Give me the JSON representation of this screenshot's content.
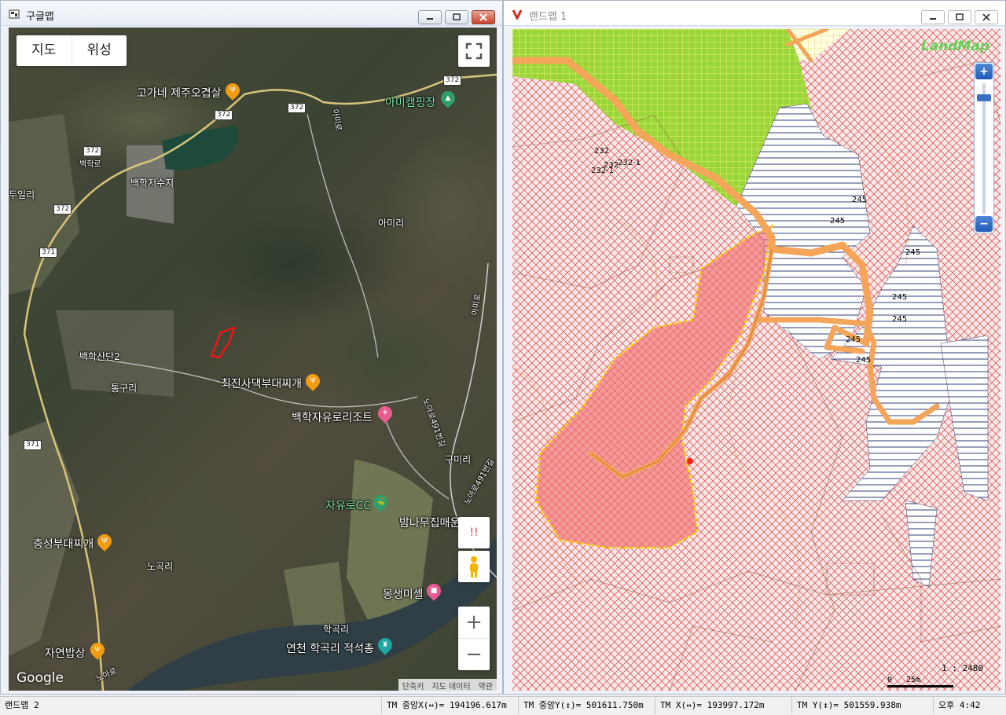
{
  "left_window": {
    "title": "구글맵",
    "map_types": [
      "지도",
      "위성"
    ],
    "labels": [
      {
        "text": "고가네 제주오겹살",
        "cls": "big"
      },
      {
        "text": "아미캠핑장",
        "cls": "big green"
      },
      {
        "text": "최진사댁부대찌개",
        "cls": "big"
      },
      {
        "text": "백학자유로리조트",
        "cls": "big"
      },
      {
        "text": "자유로CC",
        "cls": "big green"
      },
      {
        "text": "밤나무집매운",
        "cls": "big"
      },
      {
        "text": "충성부대찌개",
        "cls": "big"
      },
      {
        "text": "몽생미셸",
        "cls": "big"
      },
      {
        "text": "연천 학곡리 적석총",
        "cls": "big"
      },
      {
        "text": "자연밥상",
        "cls": "big"
      },
      {
        "text": "아미리",
        "cls": ""
      },
      {
        "text": "백학로",
        "cls": "small"
      },
      {
        "text": "두일리",
        "cls": ""
      },
      {
        "text": "백학저수지",
        "cls": ""
      },
      {
        "text": "통구리",
        "cls": ""
      },
      {
        "text": "백학산단2",
        "cls": ""
      },
      {
        "text": "구미리",
        "cls": ""
      },
      {
        "text": "노곡리",
        "cls": ""
      },
      {
        "text": "학곡리",
        "cls": ""
      },
      {
        "text": "노아로491번길",
        "cls": "small"
      },
      {
        "text": "아미로",
        "cls": "small"
      },
      {
        "text": "노아로",
        "cls": "small"
      },
      {
        "text": "아미로",
        "cls": "small"
      },
      {
        "text": "노아로491번길",
        "cls": "small"
      },
      {
        "text": "노아로",
        "cls": "small"
      }
    ],
    "shields": [
      "372",
      "372",
      "372",
      "372",
      "372",
      "371",
      "371"
    ],
    "footer": [
      "단축키",
      "지도 데이터",
      "약관"
    ],
    "logo": "Google",
    "zoom_in": "+",
    "zoom_out": "−",
    "alert_btn": "!!"
  },
  "right_window": {
    "title": "랜드맵 1",
    "logo": "LandMap",
    "parcel_numbers": [
      "232",
      "232",
      "232-1",
      "232-1",
      "245",
      "245",
      "245",
      "245",
      "245",
      "245",
      "245"
    ],
    "scale": "1 : 2480",
    "scale_zero": "0",
    "scale_dist": "25m",
    "zoom_plus": "+",
    "zoom_minus": "−"
  },
  "statusbar": {
    "cells": [
      "랜드맵 2",
      "TM 중앙X(↔)= 194196.617m",
      "TM 중앙Y(↕)= 501611.750m",
      "TM X(↔)= 193997.172m",
      "TM Y(↕)= 501559.938m",
      "오후 4:42"
    ]
  },
  "colors": {
    "zone_hatch": "#d94040",
    "green_zone": "#9ad63a",
    "road": "#f5a55a",
    "highlight": "#f07070",
    "parcel_outline": "#e8e000"
  }
}
